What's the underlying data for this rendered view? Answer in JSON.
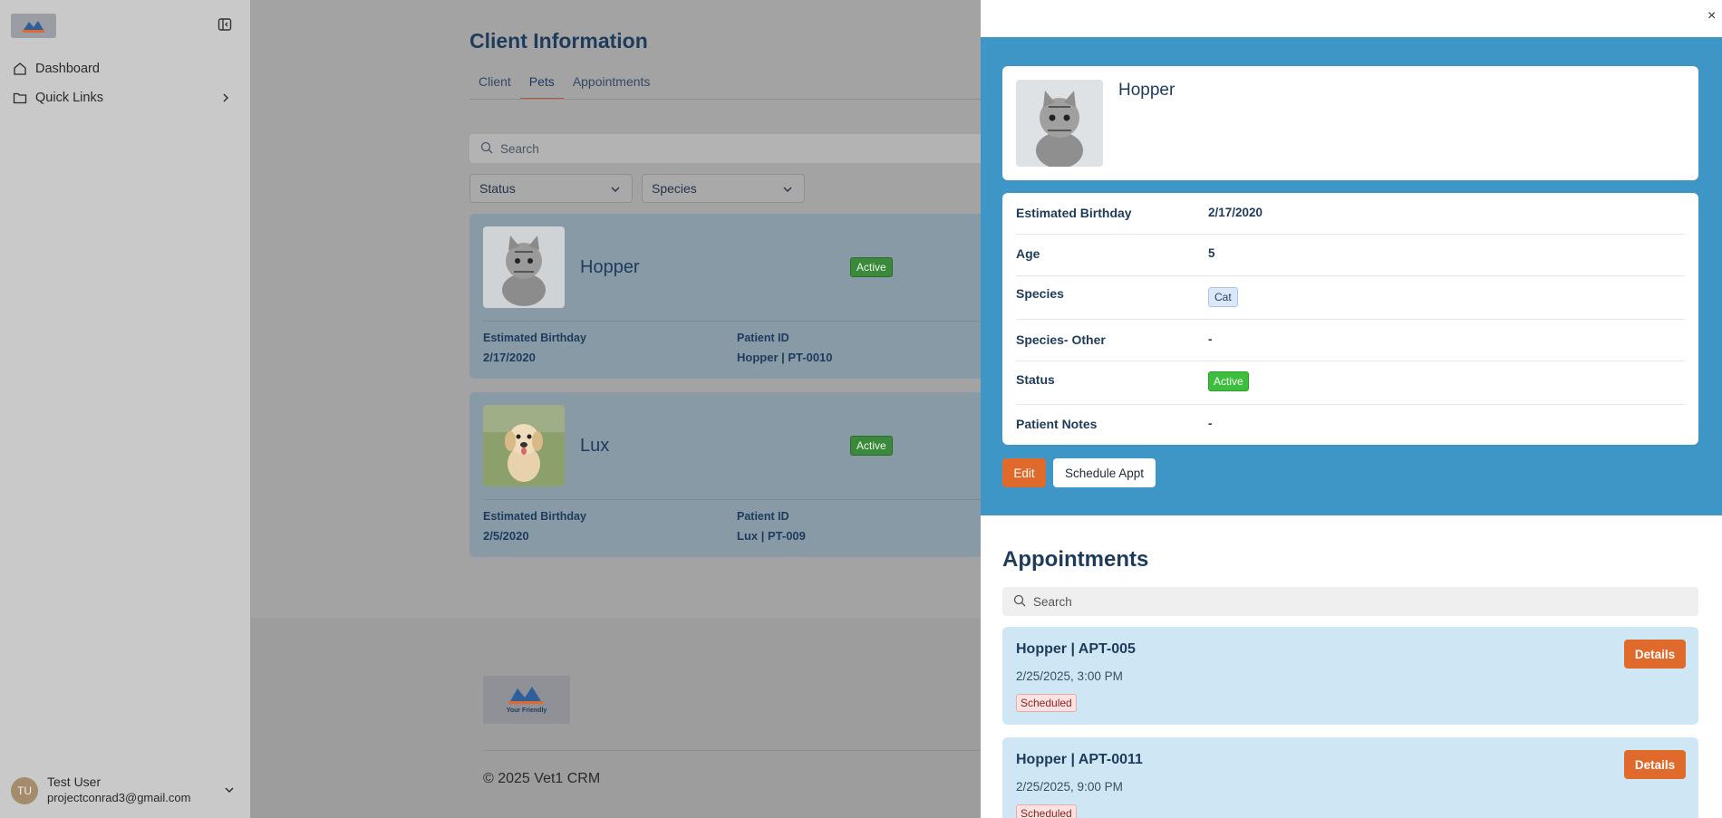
{
  "sidebar": {
    "nav": [
      {
        "label": "Dashboard",
        "icon": "home-icon"
      },
      {
        "label": "Quick Links",
        "icon": "folder-icon"
      }
    ],
    "user": {
      "initials": "TU",
      "name": "Test User",
      "email": "projectconrad3@gmail.com"
    }
  },
  "main": {
    "title": "Client Information",
    "tabs": [
      {
        "label": "Client"
      },
      {
        "label": "Pets"
      },
      {
        "label": "Appointments"
      }
    ],
    "search_placeholder": "Search",
    "filters": {
      "status": "Status",
      "species": "Species"
    },
    "pets": [
      {
        "name": "Hopper",
        "status": "Active",
        "birthday_label": "Estimated Birthday",
        "birthday": "2/17/2020",
        "pid_label": "Patient ID",
        "pid": "Hopper | PT-0010"
      },
      {
        "name": "Lux",
        "status": "Active",
        "birthday_label": "Estimated Birthday",
        "birthday": "2/5/2020",
        "pid_label": "Patient ID",
        "pid": "Lux | PT-009"
      }
    ],
    "logo_text": {
      "line1": "Your Friendly"
    },
    "copyright": "© 2025 Vet1 CRM"
  },
  "drawer": {
    "close": "×",
    "pet_name": "Hopper",
    "details": [
      {
        "label": "Estimated Birthday",
        "value": "2/17/2020"
      },
      {
        "label": "Age",
        "value": "5"
      },
      {
        "label": "Species",
        "value": "Cat"
      },
      {
        "label": "Species- Other",
        "value": "-"
      },
      {
        "label": "Status",
        "value": "Active"
      },
      {
        "label": "Patient Notes",
        "value": "-"
      }
    ],
    "edit_label": "Edit",
    "schedule_label": "Schedule Appt",
    "appointments_title": "Appointments",
    "appt_search_placeholder": "Search",
    "appointments": [
      {
        "name": "Hopper | APT-005",
        "time": "2/25/2025, 3:00 PM",
        "status": "Scheduled",
        "button": "Details"
      },
      {
        "name": "Hopper | APT-0011",
        "time": "2/25/2025, 9:00 PM",
        "status": "Scheduled",
        "button": "Details"
      }
    ]
  },
  "colors": {
    "accent": "#e06a2c",
    "band": "#3d96c6",
    "active": "#3dbe3d",
    "navy": "#1f3b5c"
  }
}
